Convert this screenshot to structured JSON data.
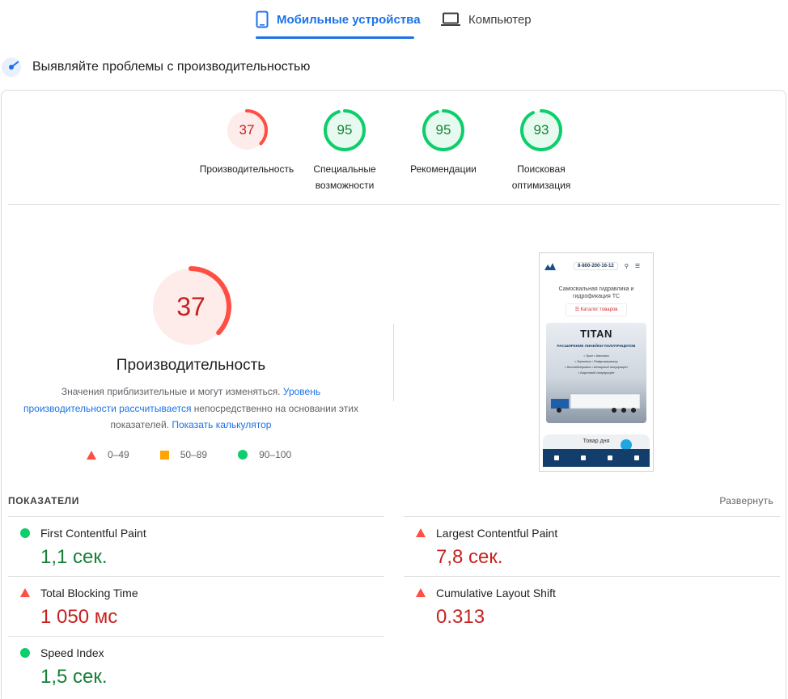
{
  "tabs": {
    "mobile_label": "Мобильные устройства",
    "desktop_label": "Компьютер",
    "active": "mobile"
  },
  "diagnose": {
    "title": "Выявляйте проблемы с производительностью"
  },
  "categories": [
    {
      "score": "37",
      "label_line1": "Производительность",
      "label_line2": "",
      "status": "poor",
      "fraction": 0.37
    },
    {
      "score": "95",
      "label_line1": "Специальные",
      "label_line2": "возможности",
      "status": "good",
      "fraction": 0.95
    },
    {
      "score": "95",
      "label_line1": "Рекомендации",
      "label_line2": "",
      "status": "good",
      "fraction": 0.95
    },
    {
      "score": "93",
      "label_line1": "Поисковая",
      "label_line2": "оптимизация",
      "status": "good",
      "fraction": 0.93
    }
  ],
  "performance": {
    "score": "37",
    "fraction": 0.37,
    "title": "Производительность",
    "desc_part1": "Значения приблизительные и могут изменяться. ",
    "desc_link1": "Уровень производительности рассчитывается",
    "desc_part2": " непосредственно на основании этих показателей. ",
    "desc_link2": "Показать калькулятор"
  },
  "legend": {
    "poor": "0–49",
    "average": "50–89",
    "good": "90–100"
  },
  "screenshot": {
    "phone": "8-800-200-16-12",
    "caption_line1": "Самосвальная гидравлика и",
    "caption_line2": "гидрофикация ТС",
    "catalog": "Каталог товаров",
    "brand": "TITAN",
    "banner_sub": "РАСШИРЕНИЕ ЛИНЕЙКИ ПОЛУПРИЦЕПОВ",
    "banner_list": [
      "• Трал • Автовоз",
      "• Зерновоз • Рефрижератор",
      "• Контейнеровоз • Шторный полуприцеп",
      "• Бортовой полуприцеп"
    ],
    "day_label": "Товар дня"
  },
  "metrics_header": {
    "label": "ПОКАЗАТЕЛИ",
    "expand": "Развернуть"
  },
  "metrics": [
    {
      "name": "First Contentful Paint",
      "value": "1,1 сек.",
      "status": "good"
    },
    {
      "name": "Largest Contentful Paint",
      "value": "7,8 сек.",
      "status": "poor"
    },
    {
      "name": "Total Blocking Time",
      "value": "1 050 мс",
      "status": "poor"
    },
    {
      "name": "Cumulative Layout Shift",
      "value": "0.313",
      "status": "poor"
    },
    {
      "name": "Speed Index",
      "value": "1,5 сек.",
      "status": "good"
    }
  ],
  "colors": {
    "accent": "#1a73e8",
    "good": "#0cce6b",
    "good_text": "#188038",
    "poor": "#ff4e42",
    "poor_text": "#c5221f",
    "average": "#ffa400"
  }
}
